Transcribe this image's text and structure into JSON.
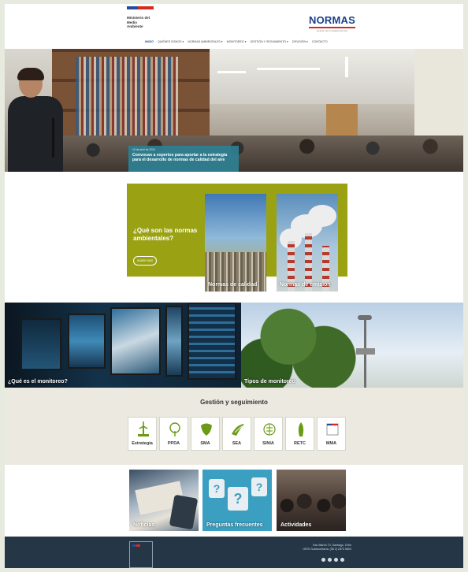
{
  "header": {
    "gov_logo_lines": [
      "Ministerio del",
      "Medio",
      "Ambiente"
    ],
    "brand_title": "NORMAS",
    "brand_subtitle": "Gestión de la Calidad del Aire"
  },
  "nav": {
    "items": [
      {
        "label": "Inicio",
        "active": true
      },
      {
        "label": "Quiénes somos ▾",
        "active": false
      },
      {
        "label": "Normas ambientales ▾",
        "active": false
      },
      {
        "label": "Monitoreo ▾",
        "active": false
      },
      {
        "label": "Gestión y seguimiento ▾",
        "active": false
      },
      {
        "label": "Difusión ▾",
        "active": false
      },
      {
        "label": "Contacto",
        "active": false
      }
    ]
  },
  "hero": {
    "caption_date": "19 de abril de 2024",
    "caption_title": "Convocan a expertos para aportar a la estrategia para el desarrollo de normas de calidad del aire"
  },
  "normas": {
    "question": "¿Qué son las normas ambientales?",
    "button_label": "Saber más",
    "cards": [
      {
        "label": "Normas de calidad"
      },
      {
        "label": "Normas de emisión"
      }
    ]
  },
  "monitoreo": {
    "left_label": "¿Qué es el monitoreo?",
    "right_label": "Tipos de monitoreo"
  },
  "gestion": {
    "title": "Gestión y seguimiento",
    "tiles": [
      {
        "label": "Estrategia",
        "icon": "wind-turbine-icon"
      },
      {
        "label": "PPDA",
        "icon": "tree-icon"
      },
      {
        "label": "SMA",
        "icon": "leaf-icon"
      },
      {
        "label": "SEA",
        "icon": "sea-logo-icon"
      },
      {
        "label": "SINIA",
        "icon": "sinia-logo-icon"
      },
      {
        "label": "RETC",
        "icon": "retc-logo-icon"
      },
      {
        "label": "MMA",
        "icon": "mma-logo-icon"
      }
    ]
  },
  "bottom_cards": {
    "noticias": "Noticias",
    "preguntas": "Preguntas frecuentes",
    "actividades": "Actividades"
  },
  "footer": {
    "address_line1": "San Martín 73, Santiago, Chile",
    "address_line2": "OIRS Subsecretaría: (56 2) 2573 5600"
  },
  "colors": {
    "brand_blue": "#1c3f8a",
    "gov_red": "#d52b1e",
    "olive_panel": "#9aa213",
    "caption_teal": "#2e8093",
    "tile_green": "#6a9a16",
    "footer_navy": "#253746"
  }
}
